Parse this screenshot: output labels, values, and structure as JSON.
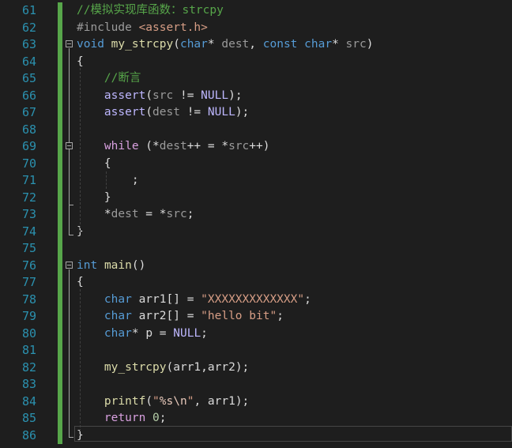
{
  "colors": {
    "background": "#1e1e1e",
    "line_number": "#2b91af",
    "change_bar": "#57a64a"
  },
  "lines": [
    {
      "n": "61",
      "tokens": [
        {
          "t": "//模拟实现库函数：strcpy",
          "c": "cmt"
        }
      ]
    },
    {
      "n": "62",
      "tokens": [
        {
          "t": "#include ",
          "c": "pre"
        },
        {
          "t": "<assert.h>",
          "c": "str"
        }
      ]
    },
    {
      "n": "63",
      "tokens": [
        {
          "t": "void",
          "c": "kw"
        },
        {
          "t": " ",
          "c": ""
        },
        {
          "t": "my_strcpy",
          "c": "fn"
        },
        {
          "t": "(",
          "c": ""
        },
        {
          "t": "char",
          "c": "kw"
        },
        {
          "t": "* ",
          "c": ""
        },
        {
          "t": "dest",
          "c": "param"
        },
        {
          "t": ", ",
          "c": ""
        },
        {
          "t": "const",
          "c": "kw"
        },
        {
          "t": " ",
          "c": ""
        },
        {
          "t": "char",
          "c": "kw"
        },
        {
          "t": "* ",
          "c": ""
        },
        {
          "t": "src",
          "c": "param"
        },
        {
          "t": ")",
          "c": ""
        }
      ]
    },
    {
      "n": "64",
      "tokens": [
        {
          "t": "{",
          "c": ""
        }
      ]
    },
    {
      "n": "65",
      "tokens": [
        {
          "t": "    ",
          "c": ""
        },
        {
          "t": "//断言",
          "c": "cmt"
        }
      ]
    },
    {
      "n": "66",
      "tokens": [
        {
          "t": "    ",
          "c": ""
        },
        {
          "t": "assert",
          "c": "macro"
        },
        {
          "t": "(",
          "c": ""
        },
        {
          "t": "src",
          "c": "param"
        },
        {
          "t": " != ",
          "c": ""
        },
        {
          "t": "NULL",
          "c": "macro"
        },
        {
          "t": ");",
          "c": ""
        }
      ]
    },
    {
      "n": "67",
      "tokens": [
        {
          "t": "    ",
          "c": ""
        },
        {
          "t": "assert",
          "c": "macro"
        },
        {
          "t": "(",
          "c": ""
        },
        {
          "t": "dest",
          "c": "param"
        },
        {
          "t": " != ",
          "c": ""
        },
        {
          "t": "NULL",
          "c": "macro"
        },
        {
          "t": ");",
          "c": ""
        }
      ]
    },
    {
      "n": "68",
      "tokens": []
    },
    {
      "n": "69",
      "tokens": [
        {
          "t": "    ",
          "c": ""
        },
        {
          "t": "while",
          "c": "ctl"
        },
        {
          "t": " (*",
          "c": ""
        },
        {
          "t": "dest",
          "c": "param"
        },
        {
          "t": "++ = *",
          "c": ""
        },
        {
          "t": "src",
          "c": "param"
        },
        {
          "t": "++)",
          "c": ""
        }
      ]
    },
    {
      "n": "70",
      "tokens": [
        {
          "t": "    {",
          "c": ""
        }
      ]
    },
    {
      "n": "71",
      "tokens": [
        {
          "t": "        ;",
          "c": ""
        }
      ]
    },
    {
      "n": "72",
      "tokens": [
        {
          "t": "    }",
          "c": ""
        }
      ]
    },
    {
      "n": "73",
      "tokens": [
        {
          "t": "    *",
          "c": ""
        },
        {
          "t": "dest",
          "c": "param"
        },
        {
          "t": " = *",
          "c": ""
        },
        {
          "t": "src",
          "c": "param"
        },
        {
          "t": ";",
          "c": ""
        }
      ]
    },
    {
      "n": "74",
      "tokens": [
        {
          "t": "}",
          "c": ""
        }
      ]
    },
    {
      "n": "75",
      "tokens": []
    },
    {
      "n": "76",
      "tokens": [
        {
          "t": "int",
          "c": "kw"
        },
        {
          "t": " ",
          "c": ""
        },
        {
          "t": "main",
          "c": "fn"
        },
        {
          "t": "()",
          "c": ""
        }
      ]
    },
    {
      "n": "77",
      "tokens": [
        {
          "t": "{",
          "c": ""
        }
      ]
    },
    {
      "n": "78",
      "tokens": [
        {
          "t": "    ",
          "c": ""
        },
        {
          "t": "char",
          "c": "kw"
        },
        {
          "t": " ",
          "c": ""
        },
        {
          "t": "arr1",
          "c": "var"
        },
        {
          "t": "[] = ",
          "c": ""
        },
        {
          "t": "\"XXXXXXXXXXXXX\"",
          "c": "str"
        },
        {
          "t": ";",
          "c": ""
        }
      ]
    },
    {
      "n": "79",
      "tokens": [
        {
          "t": "    ",
          "c": ""
        },
        {
          "t": "char",
          "c": "kw"
        },
        {
          "t": " ",
          "c": ""
        },
        {
          "t": "arr2",
          "c": "var"
        },
        {
          "t": "[] = ",
          "c": ""
        },
        {
          "t": "\"hello bit\"",
          "c": "str"
        },
        {
          "t": ";",
          "c": ""
        }
      ]
    },
    {
      "n": "80",
      "tokens": [
        {
          "t": "    ",
          "c": ""
        },
        {
          "t": "char",
          "c": "kw"
        },
        {
          "t": "* ",
          "c": ""
        },
        {
          "t": "p",
          "c": "var"
        },
        {
          "t": " = ",
          "c": ""
        },
        {
          "t": "NULL",
          "c": "macro"
        },
        {
          "t": ";",
          "c": ""
        }
      ]
    },
    {
      "n": "81",
      "tokens": []
    },
    {
      "n": "82",
      "tokens": [
        {
          "t": "    ",
          "c": ""
        },
        {
          "t": "my_strcpy",
          "c": "fn"
        },
        {
          "t": "(",
          "c": ""
        },
        {
          "t": "arr1",
          "c": "var"
        },
        {
          "t": ",",
          "c": ""
        },
        {
          "t": "arr2",
          "c": "var"
        },
        {
          "t": ");",
          "c": ""
        }
      ]
    },
    {
      "n": "83",
      "tokens": []
    },
    {
      "n": "84",
      "tokens": [
        {
          "t": "    ",
          "c": ""
        },
        {
          "t": "printf",
          "c": "fn"
        },
        {
          "t": "(",
          "c": ""
        },
        {
          "t": "\"",
          "c": "str"
        },
        {
          "t": "%s\\n",
          "c": "esc"
        },
        {
          "t": "\"",
          "c": "str"
        },
        {
          "t": ", ",
          "c": ""
        },
        {
          "t": "arr1",
          "c": "var"
        },
        {
          "t": ");",
          "c": ""
        }
      ]
    },
    {
      "n": "85",
      "tokens": [
        {
          "t": "    ",
          "c": ""
        },
        {
          "t": "return",
          "c": "ctl"
        },
        {
          "t": " ",
          "c": ""
        },
        {
          "t": "0",
          "c": "num"
        },
        {
          "t": ";",
          "c": ""
        }
      ]
    },
    {
      "n": "86",
      "tokens": [
        {
          "t": "}",
          "c": ""
        }
      ]
    }
  ]
}
